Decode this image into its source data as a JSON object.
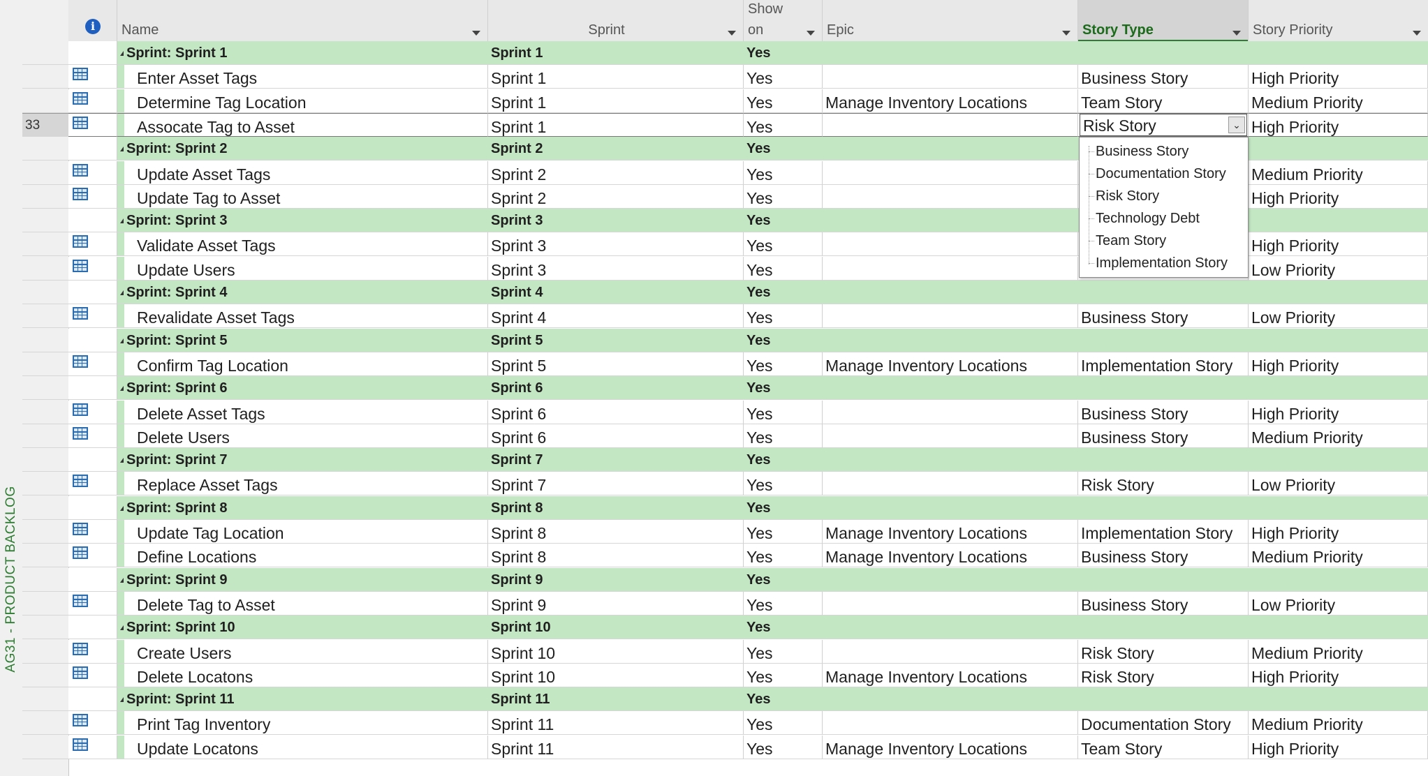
{
  "view_label": "AG31 - PRODUCT BACKLOG",
  "selected_row_number": "33",
  "columns": {
    "info": "i",
    "name": "Name",
    "sprint": "Sprint",
    "show_line1": "Show",
    "show_line2": "on",
    "epic": "Epic",
    "story_type": "Story Type",
    "story_priority": "Story Priority"
  },
  "rows": [
    {
      "kind": "group",
      "name": "Sprint: Sprint 1",
      "sprint": "Sprint 1",
      "show": "Yes",
      "epic": "",
      "type": "",
      "priority": ""
    },
    {
      "kind": "task",
      "name": "Enter Asset Tags",
      "sprint": "Sprint 1",
      "show": "Yes",
      "epic": "",
      "type": "Business Story",
      "priority": "High Priority"
    },
    {
      "kind": "task",
      "name": "Determine Tag Location",
      "sprint": "Sprint 1",
      "show": "Yes",
      "epic": "Manage Inventory Locations",
      "type": "Team Story",
      "priority": "Medium Priority"
    },
    {
      "kind": "task",
      "name": "Assocate Tag to Asset",
      "sprint": "Sprint 1",
      "show": "Yes",
      "epic": "",
      "type": "",
      "priority": "High Priority",
      "selected": true
    },
    {
      "kind": "group",
      "name": "Sprint: Sprint 2",
      "sprint": "Sprint 2",
      "show": "Yes",
      "epic": "",
      "type": "",
      "priority": ""
    },
    {
      "kind": "task",
      "name": "Update Asset Tags",
      "sprint": "Sprint 2",
      "show": "Yes",
      "epic": "",
      "type": "",
      "priority": "Medium Priority"
    },
    {
      "kind": "task",
      "name": "Update Tag to Asset",
      "sprint": "Sprint 2",
      "show": "Yes",
      "epic": "",
      "type": "",
      "priority": "High Priority"
    },
    {
      "kind": "group",
      "name": "Sprint: Sprint 3",
      "sprint": "Sprint 3",
      "show": "Yes",
      "epic": "",
      "type": "",
      "priority": ""
    },
    {
      "kind": "task",
      "name": "Validate Asset Tags",
      "sprint": "Sprint 3",
      "show": "Yes",
      "epic": "",
      "type": "",
      "priority": "High Priority"
    },
    {
      "kind": "task",
      "name": "Update Users",
      "sprint": "Sprint 3",
      "show": "Yes",
      "epic": "",
      "type": "",
      "priority": "Low Priority"
    },
    {
      "kind": "group",
      "name": "Sprint: Sprint 4",
      "sprint": "Sprint 4",
      "show": "Yes",
      "epic": "",
      "type": "",
      "priority": ""
    },
    {
      "kind": "task",
      "name": "Revalidate Asset Tags",
      "sprint": "Sprint 4",
      "show": "Yes",
      "epic": "",
      "type": "Business Story",
      "priority": "Low Priority"
    },
    {
      "kind": "group",
      "name": "Sprint: Sprint 5",
      "sprint": "Sprint 5",
      "show": "Yes",
      "epic": "",
      "type": "",
      "priority": ""
    },
    {
      "kind": "task",
      "name": "Confirm Tag Location",
      "sprint": "Sprint 5",
      "show": "Yes",
      "epic": "Manage Inventory Locations",
      "type": "Implementation Story",
      "priority": "High Priority"
    },
    {
      "kind": "group",
      "name": "Sprint: Sprint 6",
      "sprint": "Sprint 6",
      "show": "Yes",
      "epic": "",
      "type": "",
      "priority": ""
    },
    {
      "kind": "task",
      "name": "Delete Asset Tags",
      "sprint": "Sprint 6",
      "show": "Yes",
      "epic": "",
      "type": "Business Story",
      "priority": "High Priority"
    },
    {
      "kind": "task",
      "name": "Delete Users",
      "sprint": "Sprint 6",
      "show": "Yes",
      "epic": "",
      "type": "Business Story",
      "priority": "Medium Priority"
    },
    {
      "kind": "group",
      "name": "Sprint: Sprint 7",
      "sprint": "Sprint 7",
      "show": "Yes",
      "epic": "",
      "type": "",
      "priority": ""
    },
    {
      "kind": "task",
      "name": "Replace Asset Tags",
      "sprint": "Sprint 7",
      "show": "Yes",
      "epic": "",
      "type": "Risk Story",
      "priority": "Low Priority"
    },
    {
      "kind": "group",
      "name": "Sprint: Sprint 8",
      "sprint": "Sprint 8",
      "show": "Yes",
      "epic": "",
      "type": "",
      "priority": ""
    },
    {
      "kind": "task",
      "name": "Update Tag Location",
      "sprint": "Sprint 8",
      "show": "Yes",
      "epic": "Manage Inventory Locations",
      "type": "Implementation Story",
      "priority": "High Priority"
    },
    {
      "kind": "task",
      "name": "Define Locations",
      "sprint": "Sprint 8",
      "show": "Yes",
      "epic": "Manage Inventory Locations",
      "type": "Business Story",
      "priority": "Medium Priority"
    },
    {
      "kind": "group",
      "name": "Sprint: Sprint 9",
      "sprint": "Sprint 9",
      "show": "Yes",
      "epic": "",
      "type": "",
      "priority": ""
    },
    {
      "kind": "task",
      "name": "Delete Tag to Asset",
      "sprint": "Sprint 9",
      "show": "Yes",
      "epic": "",
      "type": "Business Story",
      "priority": "Low Priority"
    },
    {
      "kind": "group",
      "name": "Sprint: Sprint 10",
      "sprint": "Sprint 10",
      "show": "Yes",
      "epic": "",
      "type": "",
      "priority": ""
    },
    {
      "kind": "task",
      "name": "Create Users",
      "sprint": "Sprint 10",
      "show": "Yes",
      "epic": "",
      "type": "Risk Story",
      "priority": "Medium Priority"
    },
    {
      "kind": "task",
      "name": "Delete Locatons",
      "sprint": "Sprint 10",
      "show": "Yes",
      "epic": "Manage Inventory Locations",
      "type": "Risk Story",
      "priority": "High Priority"
    },
    {
      "kind": "group",
      "name": "Sprint: Sprint 11",
      "sprint": "Sprint 11",
      "show": "Yes",
      "epic": "",
      "type": "",
      "priority": ""
    },
    {
      "kind": "task",
      "name": "Print Tag Inventory",
      "sprint": "Sprint 11",
      "show": "Yes",
      "epic": "",
      "type": "Documentation Story",
      "priority": "Medium Priority"
    },
    {
      "kind": "task",
      "name": "Update Locatons",
      "sprint": "Sprint 11",
      "show": "Yes",
      "epic": "Manage Inventory Locations",
      "type": "Team Story",
      "priority": "High Priority"
    }
  ],
  "editor": {
    "value": "Risk Story",
    "options": [
      "Business Story",
      "Documentation Story",
      "Risk Story",
      "Technology Debt",
      "Team Story",
      "Implementation Story"
    ]
  },
  "colors": {
    "group_row": "#c3e6c3",
    "accent_green": "#2e7d32",
    "task_icon": "#2b6cb0"
  }
}
